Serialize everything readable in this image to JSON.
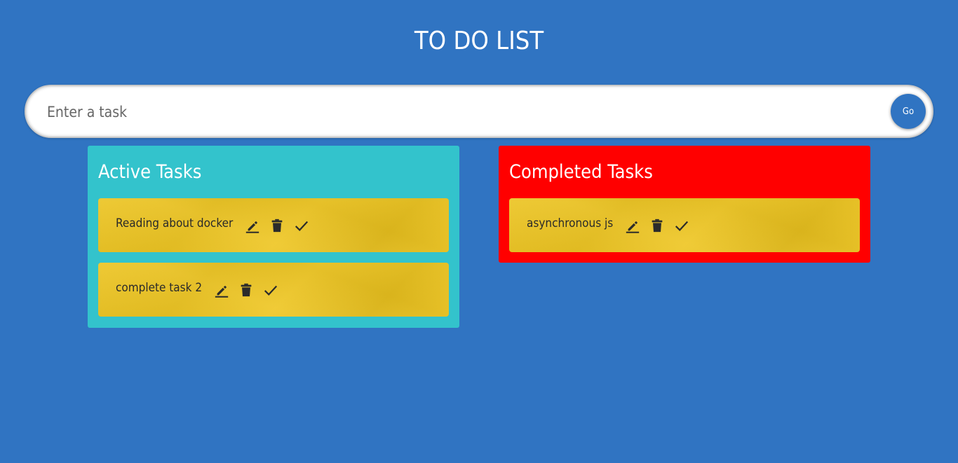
{
  "header": {
    "title": "TO DO LIST"
  },
  "search": {
    "placeholder": "Enter a task",
    "value": "",
    "go_label": "Go"
  },
  "active": {
    "title": "Active Tasks",
    "tasks": [
      {
        "text": "Reading about docker"
      },
      {
        "text": "complete task 2"
      }
    ]
  },
  "completed": {
    "title": "Completed Tasks",
    "tasks": [
      {
        "text": "asynchronous js"
      }
    ]
  },
  "icons": {
    "edit": "pencil-icon",
    "delete": "trash-icon",
    "complete": "check-icon"
  },
  "colors": {
    "background": "#3074c2",
    "active_panel": "#33c3cc",
    "completed_panel": "#ff0000",
    "task_card": "#eec51f",
    "go_button": "#3074c2"
  }
}
